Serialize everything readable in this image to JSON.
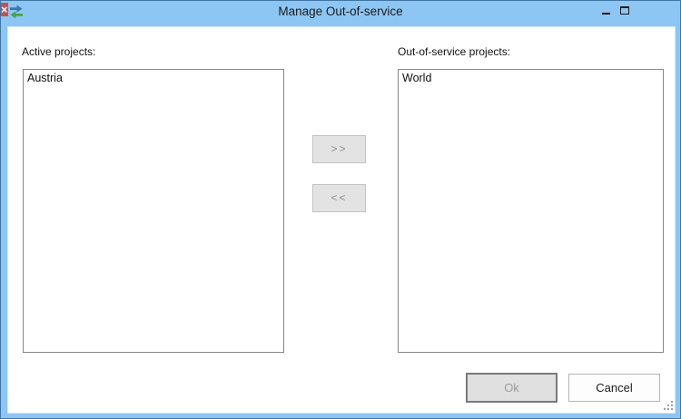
{
  "window": {
    "title": "Manage Out-of-service",
    "close_glyph": "×"
  },
  "left_panel": {
    "label": "Active projects:",
    "items": [
      "Austria"
    ]
  },
  "right_panel": {
    "label": "Out-of-service projects:",
    "items": [
      "World"
    ]
  },
  "transfer": {
    "move_right_label": ">>",
    "move_left_label": "<<"
  },
  "footer": {
    "ok_label": "Ok",
    "cancel_label": "Cancel"
  },
  "colors": {
    "titlebar_blue": "#8dc6f2",
    "window_border": "#3f75a3",
    "close_red": "#c75050",
    "icon_arrow_blue": "#3c76ac",
    "icon_arrow_green": "#47a447",
    "listbox_border": "#888888",
    "disabled_text": "#8f8f8f",
    "button_face": "#e3e3e3"
  }
}
